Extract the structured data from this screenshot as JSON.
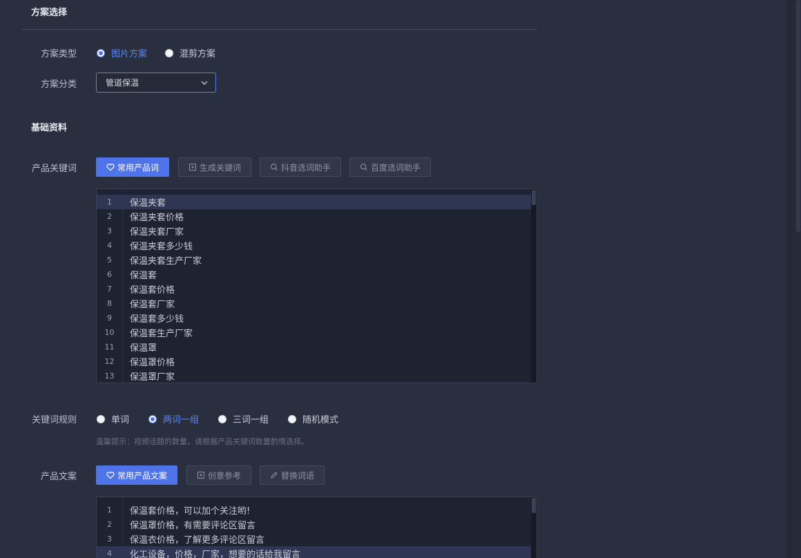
{
  "scheme": {
    "section_title": "方案选择",
    "type_label": "方案类型",
    "type_options": [
      {
        "label": "图片方案",
        "checked": true
      },
      {
        "label": "混剪方案",
        "checked": false
      }
    ],
    "category_label": "方案分类",
    "category_value": "管道保温"
  },
  "basic": {
    "section_title": "基础资料",
    "keyword_label": "产品关键词",
    "keyword_buttons": {
      "common": "常用产品词",
      "generate": "生成关键词",
      "douyin": "抖音选词助手",
      "baidu": "百度选词助手"
    },
    "keywords": [
      {
        "n": "1",
        "text": "保温夹套"
      },
      {
        "n": "2",
        "text": "保温夹套价格"
      },
      {
        "n": "3",
        "text": "保温夹套厂家"
      },
      {
        "n": "4",
        "text": "保温夹套多少钱"
      },
      {
        "n": "5",
        "text": "保温夹套生产厂家"
      },
      {
        "n": "6",
        "text": "保温套"
      },
      {
        "n": "7",
        "text": "保温套价格"
      },
      {
        "n": "8",
        "text": "保温套厂家"
      },
      {
        "n": "9",
        "text": "保温套多少钱"
      },
      {
        "n": "10",
        "text": "保温套生产厂家"
      },
      {
        "n": "11",
        "text": "保温罩"
      },
      {
        "n": "12",
        "text": "保温罩价格"
      },
      {
        "n": "13",
        "text": "保温罩厂家"
      }
    ],
    "rule_label": "关键词规则",
    "rule_options": [
      {
        "label": "单词",
        "checked": false
      },
      {
        "label": "两词一组",
        "checked": true
      },
      {
        "label": "三词一组",
        "checked": false
      },
      {
        "label": "随机模式",
        "checked": false
      }
    ],
    "hint": "温馨提示：视频话题的数量，请根据产品关键词数量酌情选择。",
    "copy_label": "产品文案",
    "copy_buttons": {
      "common": "常用产品文案",
      "creative": "创意参考",
      "replace": "替换词语"
    },
    "copies": [
      {
        "n": "1",
        "text": "保温套价格，可以加个关注哟!"
      },
      {
        "n": "2",
        "text": "保温罩价格，有需要评论区留言"
      },
      {
        "n": "3",
        "text": "保温衣价格，了解更多评论区留言"
      },
      {
        "n": "4",
        "text": "化工设备，价格，厂家，想要的话给我留言"
      }
    ]
  },
  "colors": {
    "accent": "#4f73e8",
    "background": "#2a2f3f",
    "editor_bg": "#1e2332"
  }
}
